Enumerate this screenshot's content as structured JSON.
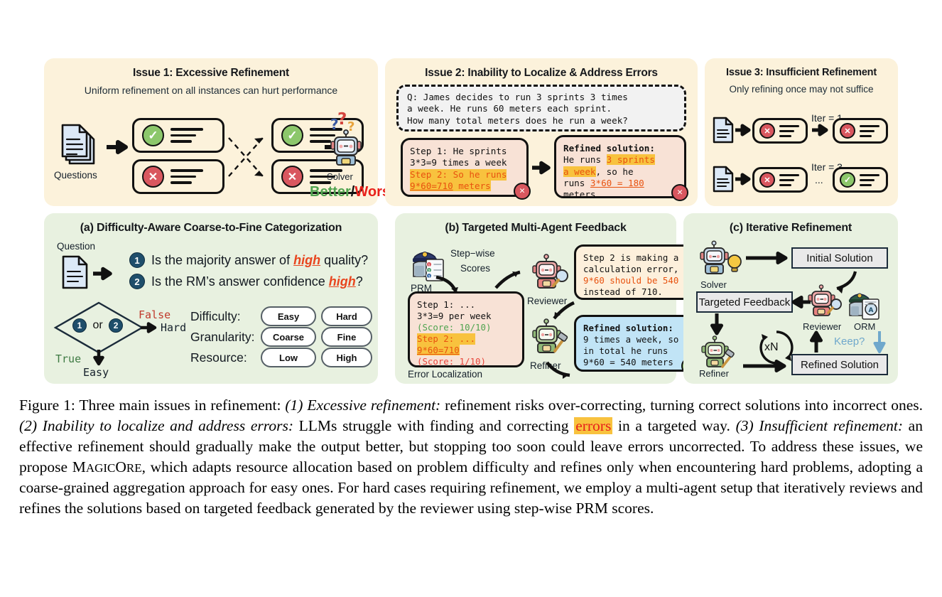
{
  "figure": {
    "panels": {
      "issue1": {
        "title": "Issue 1: Excessive Refinement",
        "subtitle": "Uniform refinement on all instances can hurt performance",
        "questions_label": "Questions",
        "solver_label": "Solver",
        "outcome_better": "Better",
        "outcome_sep": "/",
        "outcome_worse": "Worse"
      },
      "issue2": {
        "title": "Issue 2: Inability to Localize & Address Errors",
        "question": {
          "line1": "Q: James decides to run 3 sprints 3 times",
          "line2": "a week. He runs 60 meters each sprint.",
          "line3": "How many total meters does he run a week?"
        },
        "solution": {
          "l1": "Step 1: He sprints",
          "l2": "3*3=9 times a week",
          "l3": "Step 2: So he runs",
          "l4a": "9*60=710",
          "l4b": " meters"
        },
        "refined": {
          "heading": "Refined solution:",
          "l1a": "He runs ",
          "l1b": "3 sprints",
          "l2a": "a week",
          "l2b": ", so he",
          "l3a": "runs ",
          "l3b": "3*60 = 180",
          "l4": "meters"
        }
      },
      "issue3": {
        "title": "Issue 3: Insufficient Refinement",
        "subtitle": "Only refining once may not suffice",
        "iter1": "Iter = 1",
        "iter3": "Iter = 3",
        "ellipsis": "..."
      },
      "a": {
        "title": "(a) Difficulty-Aware Coarse-to-Fine Categorization",
        "question_label": "Question",
        "q1_num": "1",
        "q1_a": "Is the majority answer of ",
        "q1_hi": "high",
        "q1_b": " quality?",
        "q2_num": "2",
        "q2_a": "Is the RM’s answer confidence ",
        "q2_hi": "high",
        "q2_b": "?",
        "diamond_or": "or",
        "false_label": "False",
        "true_label": "True",
        "hard_label": "Hard",
        "easy_label": "Easy",
        "rows": [
          {
            "label": "Difficulty:",
            "left": "Easy",
            "right": "Hard"
          },
          {
            "label": "Granularity:",
            "left": "Coarse",
            "right": "Fine"
          },
          {
            "label": "Resource:",
            "left": "Low",
            "right": "High"
          }
        ]
      },
      "b": {
        "title": "(b) Targeted Multi-Agent Feedback",
        "prm_label": "PRM",
        "stepwise_l1": "Step−wise",
        "stepwise_l2": "Scores",
        "reviewer_label": "Reviewer",
        "refiner_label": "Refiner",
        "error_localization": "Error Localization",
        "steps": {
          "l1": "Step 1: ...",
          "l2": "3*3=9 per week",
          "l3": "(Score: 10/10)",
          "l4": "Step 2: ...",
          "l5": "9*60=710",
          "l6": "(Score: 1/10)"
        },
        "feedback": {
          "l1": "Step 2 is making a",
          "l2": "calculation error,",
          "l3": "9*60 should be 540",
          "l4": "instead of 710."
        },
        "refined": {
          "heading": "Refined solution:",
          "l1": "9 times a week, so",
          "l2": "in total he runs",
          "l3": "9*60 = 540 meters"
        }
      },
      "c": {
        "title": "(c) Iterative Refinement",
        "solver_label": "Solver",
        "reviewer_label": "Reviewer",
        "orm_label": "ORM",
        "refiner_label": "Refiner",
        "initial_solution": "Initial Solution",
        "targeted_feedback": "Targeted Feedback",
        "refined_solution": "Refined Solution",
        "loop_label": "xN",
        "keep_label": "Keep?"
      }
    },
    "caption": {
      "prefix": "Figure 1: Three main issues in refinement: ",
      "i1_em": "(1) Excessive refinement:",
      "i1_txt": " refinement risks over-correcting, turning correct solutions into incorrect ones. ",
      "i2_em": "(2) Inability to localize and address errors:",
      "i2_txt_a": " LLMs struggle with finding and correcting ",
      "i2_hl": "errors",
      "i2_txt_b": " in a targeted way. ",
      "i3_em": "(3) Insufficient refinement:",
      "i3_txt": " an effective refinement should gradually make the output better, but stopping too soon could leave errors uncorrected.  To address these issues, we propose ",
      "magicore_m": "M",
      "magicore_agi": "AGIC",
      "magicore_o": "O",
      "magicore_re": "RE",
      "tail": ", which adapts resource allocation based on problem difficulty and refines only when encountering hard problems, adopting a coarse-grained aggregation approach for easy ones. For hard cases requiring refinement, we employ a multi-agent setup that iteratively reviews and refines the solutions based on targeted feedback generated by the reviewer using step-wise PRM scores."
    },
    "colors": {
      "panel_cream": "#FCF2DB",
      "panel_green": "#E8F1E0",
      "correct_green": "#8CC76B",
      "incorrect_red": "#D9575F",
      "highlight_yellow": "#F8C23E",
      "orange_text": "#E8520F",
      "blue_box": "#C1E4F6",
      "peach_box": "#F8E2D6"
    }
  }
}
